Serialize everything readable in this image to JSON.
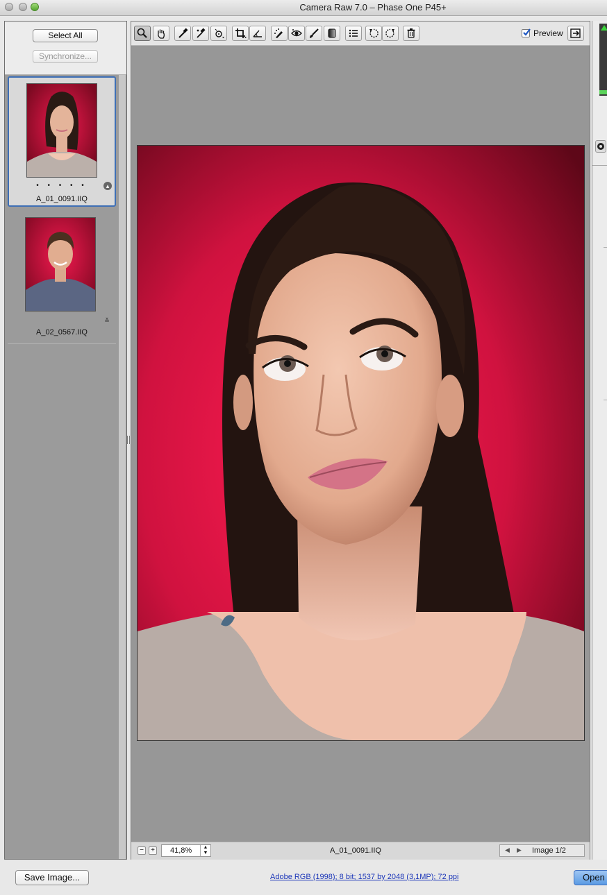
{
  "window": {
    "title": "Camera Raw 7.0  –  Phase One P45+"
  },
  "filmstrip": {
    "select_all_label": "Select All",
    "synchronize_label": "Synchronize...",
    "items": [
      {
        "filename": "A_01_0091.IIQ",
        "selected": true,
        "rating": "• • • • •"
      },
      {
        "filename": "A_02_0567.IIQ",
        "selected": false
      }
    ]
  },
  "toolbar": {
    "tools": [
      "zoom-tool",
      "hand-tool",
      "white-balance-tool",
      "color-sampler-tool",
      "targeted-adjustment-tool",
      "crop-tool",
      "straighten-tool",
      "spot-removal-tool",
      "red-eye-removal-tool",
      "adjustment-brush-tool",
      "graduated-filter-tool",
      "preferences",
      "rotate-left",
      "rotate-right",
      "delete"
    ],
    "preview_label": "Preview",
    "preview_checked": true
  },
  "status": {
    "zoom": "41,8%",
    "filename": "A_01_0091.IIQ",
    "image_count": "Image 1/2"
  },
  "bottom": {
    "save_label": "Save Image...",
    "workflow_options": "Adobe RGB (1998); 8 bit; 1537 by 2048 (3,1MP); 72 ppi",
    "open_label": "Open"
  },
  "colors": {
    "accent_blue": "#3e6fb6",
    "background_red": "#d4133f",
    "link_blue": "#1a35b8"
  }
}
